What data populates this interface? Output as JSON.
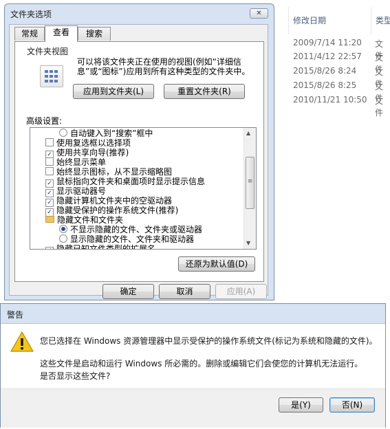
{
  "explorer": {
    "columns": {
      "date": "修改日期",
      "type": "类型"
    },
    "rows": [
      {
        "date": "2009/7/14 11:20",
        "type": "文件"
      },
      {
        "date": "2011/4/12 22:57",
        "type": "文件"
      },
      {
        "date": "2015/8/26 8:24",
        "type": "文件"
      },
      {
        "date": "2015/8/26 8:25",
        "type": "文件"
      },
      {
        "date": "2010/11/21 10:50",
        "type": "文件"
      }
    ]
  },
  "folder_options": {
    "title": "文件夹选项",
    "close_glyph": "✕",
    "tabs": [
      "常规",
      "查看",
      "搜索"
    ],
    "active_tab": "查看",
    "folder_views": {
      "legend": "文件夹视图",
      "description": "可以将该文件夹正在使用的视图(例如“详细信息”或“图标”)应用到所有这种类型的文件夹中。",
      "apply_button": "应用到文件夹(L)",
      "reset_button": "重置文件夹(R)"
    },
    "advanced_label": "高级设置:",
    "settings": [
      {
        "kind": "radio",
        "checked": false,
        "indent": 1,
        "label": "自动键入到“搜索”框中"
      },
      {
        "kind": "check",
        "checked": false,
        "indent": 0,
        "label": "使用复选框以选择项"
      },
      {
        "kind": "check",
        "checked": true,
        "indent": 0,
        "label": "使用共享向导(推荐)"
      },
      {
        "kind": "check",
        "checked": false,
        "indent": 0,
        "label": "始终显示菜单"
      },
      {
        "kind": "check",
        "checked": false,
        "indent": 0,
        "label": "始终显示图标，从不显示缩略图"
      },
      {
        "kind": "check",
        "checked": true,
        "indent": 0,
        "label": "鼠标指向文件夹和桌面项时显示提示信息"
      },
      {
        "kind": "check",
        "checked": true,
        "indent": 0,
        "label": "显示驱动器号"
      },
      {
        "kind": "check",
        "checked": true,
        "indent": 0,
        "label": "隐藏计算机文件夹中的空驱动器"
      },
      {
        "kind": "check",
        "checked": true,
        "indent": 0,
        "label": "隐藏受保护的操作系统文件(推荐)"
      },
      {
        "kind": "folder",
        "checked": false,
        "indent": 0,
        "label": "隐藏文件和文件夹"
      },
      {
        "kind": "radio",
        "checked": true,
        "indent": 1,
        "label": "不显示隐藏的文件、文件夹或驱动器"
      },
      {
        "kind": "radio",
        "checked": false,
        "indent": 1,
        "label": "显示隐藏的文件、文件夹和驱动器"
      },
      {
        "kind": "check",
        "checked": true,
        "indent": 0,
        "label": "隐藏已知文件类型的扩展名"
      }
    ],
    "restore_defaults": "还原为默认值(D)",
    "ok_button": "确定",
    "cancel_button": "取消",
    "apply_button": "应用(A)"
  },
  "warning": {
    "title": "警告",
    "line1": "您已选择在 Windows 资源管理器中显示受保护的操作系统文件(标记为系统和隐藏的文件)。",
    "line2": "这些文件是启动和运行 Windows 所必需的。删除或编辑它们会使您的计算机无法运行。",
    "line3": "是否显示这些文件?",
    "yes_button": "是(Y)",
    "no_button": "否(N)"
  }
}
